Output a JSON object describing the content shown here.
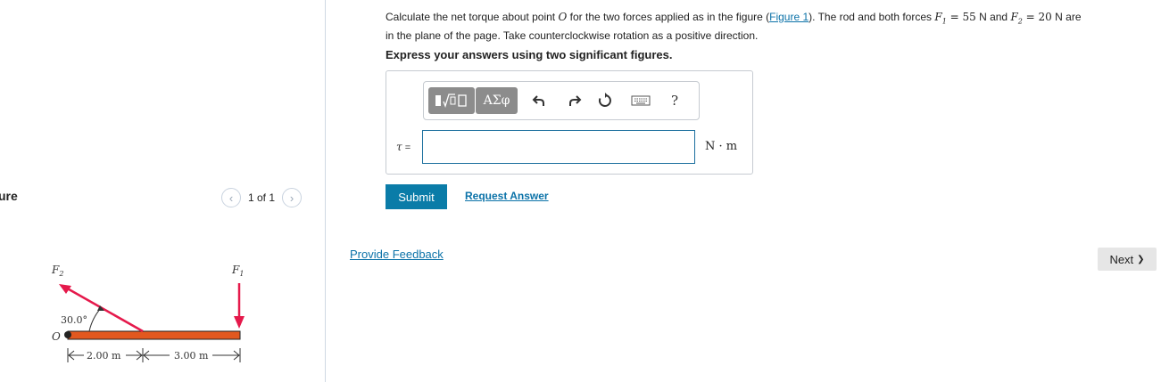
{
  "figure_panel": {
    "heading": "ure",
    "pager": {
      "prev": "‹",
      "text": "1 of 1",
      "next": "›"
    },
    "figure": {
      "force1_label": "F1",
      "force2_label": "F2",
      "angle_label": "30.0°",
      "pivot_label": "O",
      "dim1_label": "2.00 m",
      "dim2_label": "3.00 m",
      "colors": {
        "rod": "#e2581f",
        "force": "#e5194b"
      }
    }
  },
  "question": {
    "text_before_link": "Calculate the net torque about point ",
    "point": "O",
    "text_mid": " for the two forces applied as in the figure (",
    "figure_link": "Figure 1",
    "text_after_link": "). The rod and both forces ",
    "f1": "F",
    "f1_sub": "1",
    "f1_value": " = 55",
    "f1_unit": " N and ",
    "f2": "F",
    "f2_sub": "2",
    "f2_value": " = 20",
    "f2_unit": " N are",
    "line2": "in the plane of the page. Take counterclockwise rotation as a positive direction.",
    "instruction": "Express your answers using two significant figures."
  },
  "answer": {
    "toolbar": {
      "greek_label": "ΑΣφ",
      "undo_icon": "undo-icon",
      "redo_icon": "redo-icon",
      "reset_icon": "reset-icon",
      "keyboard_icon": "keyboard-icon",
      "help_label": "?"
    },
    "variable_label": "τ",
    "equals": "=",
    "input_value": "",
    "unit": "N · m"
  },
  "actions": {
    "submit_label": "Submit",
    "request_answer_label": "Request Answer",
    "feedback_label": "Provide Feedback",
    "next_label": "Next",
    "next_icon": "❯"
  },
  "colors": {
    "link": "#0b72a8",
    "submit_bg": "#0a7ca8",
    "toolbar_group": "#8c8c8c"
  }
}
